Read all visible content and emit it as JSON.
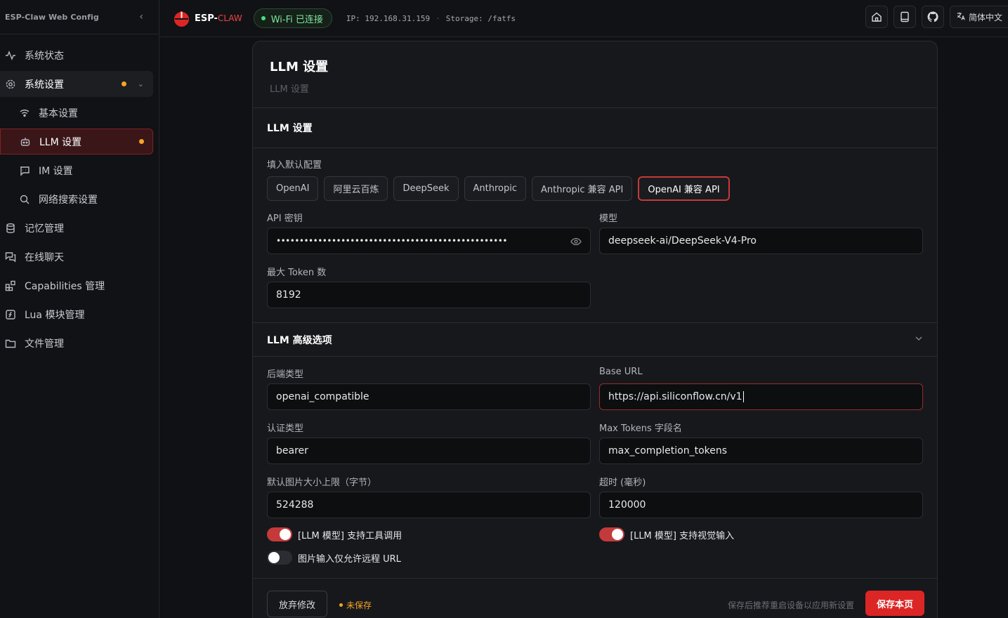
{
  "sidebar": {
    "title": "ESP-Claw Web Config",
    "items": [
      {
        "label": "系统状态",
        "icon": "activity-icon"
      },
      {
        "label": "系统设置",
        "icon": "gear-icon"
      },
      {
        "label": "基本设置",
        "icon": "wifi-icon"
      },
      {
        "label": "LLM 设置",
        "icon": "bot-icon"
      },
      {
        "label": "IM 设置",
        "icon": "chat-icon"
      },
      {
        "label": "网络搜索设置",
        "icon": "search-icon"
      },
      {
        "label": "记忆管理",
        "icon": "database-icon"
      },
      {
        "label": "在线聊天",
        "icon": "messages-icon"
      },
      {
        "label": "Capabilities 管理",
        "icon": "blocks-icon"
      },
      {
        "label": "Lua 模块管理",
        "icon": "code-file-icon"
      },
      {
        "label": "文件管理",
        "icon": "folder-icon"
      }
    ]
  },
  "topbar": {
    "logo_main": "ESP-",
    "logo_claw": "CLAW",
    "wifi_status": "Wi-Fi 已连接",
    "ip": "IP: 192.168.31.159",
    "storage": "Storage: /fatfs",
    "language": "简体中文"
  },
  "panel": {
    "title": "LLM 设置",
    "subtitle": "LLM 设置",
    "section1_title": "LLM 设置",
    "presets_label": "填入默认配置",
    "presets": [
      "OpenAI",
      "阿里云百炼",
      "DeepSeek",
      "Anthropic",
      "Anthropic 兼容 API",
      "OpenAI 兼容 API"
    ],
    "api_key_label": "API 密钥",
    "api_key_value": "••••••••••••••••••••••••••••••••••••••••••••••••••",
    "model_label": "模型",
    "model_value": "deepseek-ai/DeepSeek-V4-Pro",
    "max_token_label": "最大 Token 数",
    "max_token_value": "8192",
    "section2_title": "LLM 高级选项",
    "backend_label": "后端类型",
    "backend_value": "openai_compatible",
    "base_url_label": "Base URL",
    "base_url_value": "https://api.siliconflow.cn/v1",
    "auth_label": "认证类型",
    "auth_value": "bearer",
    "max_tokens_field_label": "Max Tokens 字段名",
    "max_tokens_field_value": "max_completion_tokens",
    "image_limit_label": "默认图片大小上限（字节）",
    "image_limit_value": "524288",
    "timeout_label": "超时 (毫秒)",
    "timeout_value": "120000",
    "toggle_tools_label": "[LLM 模型] 支持工具调用",
    "toggle_tools_on": true,
    "toggle_vision_label": "[LLM 模型] 支持视觉输入",
    "toggle_vision_on": true,
    "toggle_remote_label": "图片输入仅允许远程 URL",
    "toggle_remote_on": false
  },
  "footer": {
    "discard_label": "放弃修改",
    "unsaved_label": "未保存",
    "hint": "保存后推荐重启设备以应用新设置",
    "save_label": "保存本页"
  },
  "colors": {
    "accent": "#dc2626",
    "warning": "#f5a524",
    "success": "#4ade80"
  }
}
